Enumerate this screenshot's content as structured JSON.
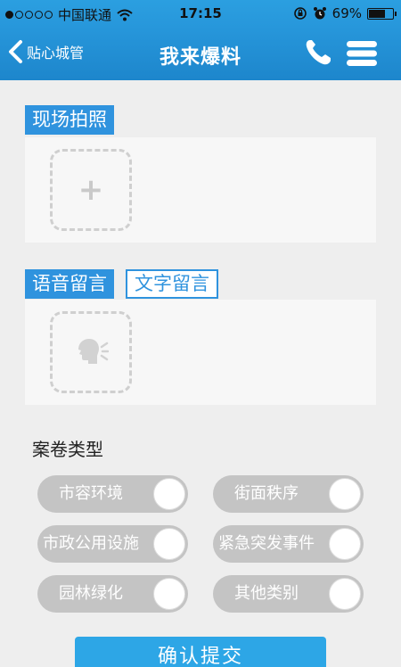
{
  "status_bar": {
    "carrier": "中国联通",
    "time": "17:15",
    "battery_percent": "69%",
    "battery_level": 0.69,
    "signal_bars": 1
  },
  "nav": {
    "back_label": "贴心城管",
    "title": "我来爆料",
    "phone_icon": "phone-icon",
    "menu_icon": "menu-icon"
  },
  "photo": {
    "label": "现场拍照",
    "add_icon": "plus-icon"
  },
  "message": {
    "tabs": [
      {
        "label": "语音留言",
        "active": true
      },
      {
        "label": "文字留言",
        "active": false
      }
    ],
    "record_icon": "voice-speaking-icon"
  },
  "case_type": {
    "title": "案卷类型",
    "options": [
      {
        "label": "市容环境",
        "selected": false
      },
      {
        "label": "街面秩序",
        "selected": false
      },
      {
        "label": "市政公用设施",
        "selected": false
      },
      {
        "label": "紧急突发事件",
        "selected": false
      },
      {
        "label": "园林绿化",
        "selected": false
      },
      {
        "label": "其他类别",
        "selected": false
      }
    ]
  },
  "submit": {
    "label": "确认提交"
  },
  "colors": {
    "accent": "#2f93de",
    "navbar": "#2797db",
    "option_bg": "#c4c4c4",
    "submit": "#2da6e6"
  }
}
